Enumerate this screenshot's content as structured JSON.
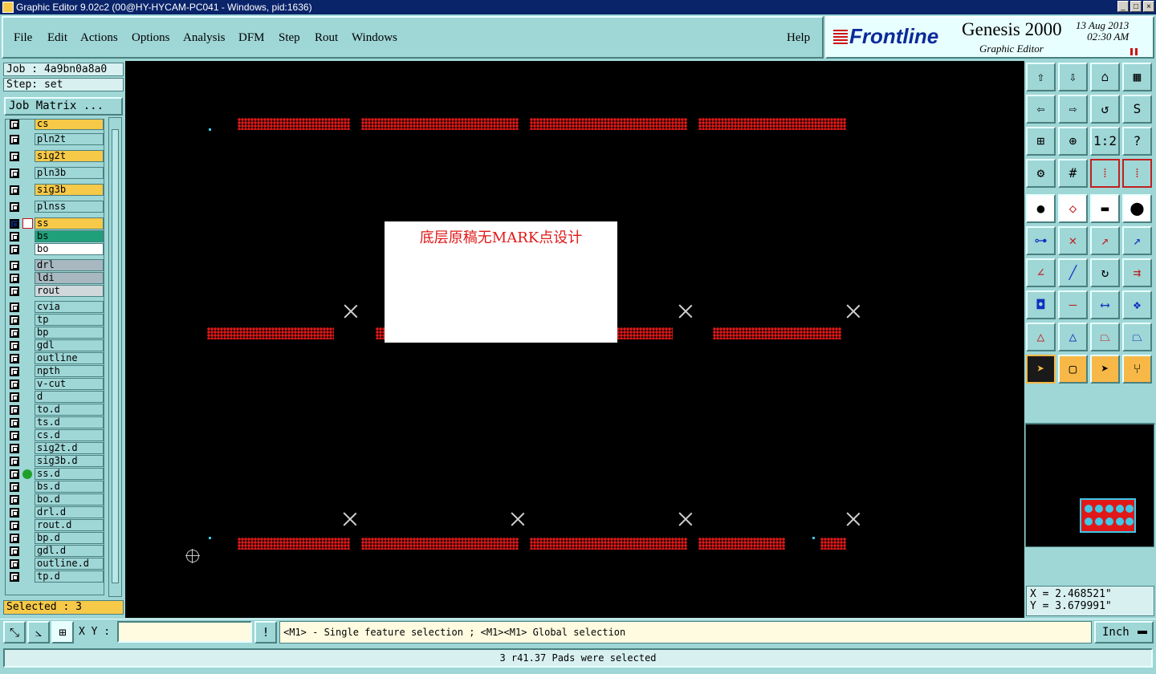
{
  "window": {
    "title": "Graphic Editor 9.02c2 (00@HY-HYCAM-PC041 - Windows, pid:1636)"
  },
  "menu": [
    {
      "label": "File"
    },
    {
      "label": "Edit"
    },
    {
      "label": "Actions"
    },
    {
      "label": "Options"
    },
    {
      "label": "Analysis"
    },
    {
      "label": "DFM"
    },
    {
      "label": "Step"
    },
    {
      "label": "Rout"
    },
    {
      "label": "Windows"
    },
    {
      "label": "Help"
    }
  ],
  "brand": {
    "logo": "Frontline",
    "product": "Genesis 2000",
    "subtitle": "Graphic Editor",
    "date": "13 Aug 2013",
    "time": "02:30 AM"
  },
  "job": {
    "job_line": "Job : 4a9bn0a8a0",
    "step_line": "Step: set",
    "matrix_button": "Job Matrix ..."
  },
  "layers": [
    {
      "name": "cs",
      "color": "#f7c948"
    },
    {
      "name": "pln2t",
      "color": "#9fd6d6"
    },
    {
      "name": "sig2t",
      "color": "#f7c948"
    },
    {
      "name": "pln3b",
      "color": "#9fd6d6"
    },
    {
      "name": "sig3b",
      "color": "#f7c948"
    },
    {
      "name": "plnss",
      "color": "#9fd6d6"
    },
    {
      "name": "ss",
      "color": "#f7c948"
    },
    {
      "name": "bs",
      "color": "#1fa07a"
    },
    {
      "name": "bo",
      "color": "#ffffff"
    },
    {
      "name": "drl",
      "color": "#a8b8c0"
    },
    {
      "name": "ldi",
      "color": "#a8b8c0"
    },
    {
      "name": "rout",
      "color": "#d0d8dc"
    },
    {
      "name": "cvia",
      "color": "#9fd6d6"
    },
    {
      "name": "tp",
      "color": "#9fd6d6"
    },
    {
      "name": "bp",
      "color": "#9fd6d6"
    },
    {
      "name": "gdl",
      "color": "#9fd6d6"
    },
    {
      "name": "outline",
      "color": "#9fd6d6"
    },
    {
      "name": "npth",
      "color": "#9fd6d6"
    },
    {
      "name": "v-cut",
      "color": "#9fd6d6"
    },
    {
      "name": "d",
      "color": "#9fd6d6"
    },
    {
      "name": "to.d",
      "color": "#9fd6d6"
    },
    {
      "name": "ts.d",
      "color": "#9fd6d6"
    },
    {
      "name": "cs.d",
      "color": "#9fd6d6"
    },
    {
      "name": "sig2t.d",
      "color": "#9fd6d6"
    },
    {
      "name": "sig3b.d",
      "color": "#9fd6d6"
    },
    {
      "name": "ss.d",
      "color": "#9fd6d6"
    },
    {
      "name": "bs.d",
      "color": "#9fd6d6"
    },
    {
      "name": "bo.d",
      "color": "#9fd6d6"
    },
    {
      "name": "drl.d",
      "color": "#9fd6d6"
    },
    {
      "name": "rout.d",
      "color": "#9fd6d6"
    },
    {
      "name": "bp.d",
      "color": "#9fd6d6"
    },
    {
      "name": "gdl.d",
      "color": "#9fd6d6"
    },
    {
      "name": "outline.d",
      "color": "#9fd6d6"
    },
    {
      "name": "tp.d",
      "color": "#9fd6d6"
    }
  ],
  "selected": "Selected : 3",
  "canvas": {
    "note": "底层原稿无MARK点设计",
    "pad_color": "#e01818"
  },
  "coords": {
    "x": "X = 2.468521\"",
    "y": "Y = 3.679991\""
  },
  "input": {
    "xy_label": "X Y :",
    "xy_value": ""
  },
  "hint": "<M1> - Single feature selection ; <M1><M1> Global selection",
  "unit": "Inch",
  "status": "3 r41.37 Pads were selected"
}
